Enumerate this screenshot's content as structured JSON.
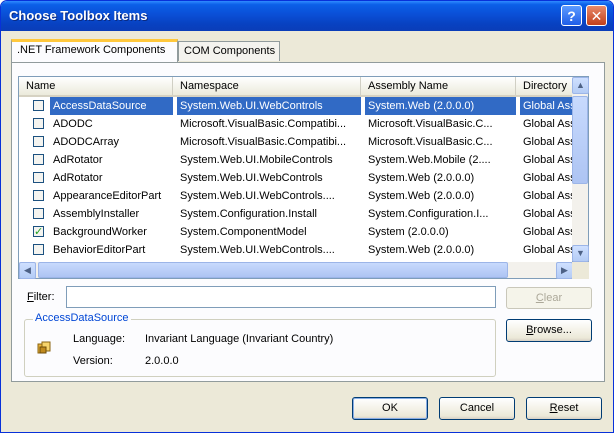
{
  "window": {
    "title": "Choose Toolbox Items",
    "help_glyph": "?",
    "close_glyph": "✕"
  },
  "tabs": [
    {
      "label": ".NET Framework Components",
      "active": true
    },
    {
      "label": "COM Components",
      "active": false
    }
  ],
  "list": {
    "columns": [
      "Name",
      "Namespace",
      "Assembly Name",
      "Directory"
    ],
    "rows": [
      {
        "checked": false,
        "selected": true,
        "name": "AccessDataSource",
        "namespace": "System.Web.UI.WebControls",
        "assembly": "System.Web (2.0.0.0)",
        "directory": "Global Ass"
      },
      {
        "checked": false,
        "selected": false,
        "name": "ADODC",
        "namespace": "Microsoft.VisualBasic.Compatibi...",
        "assembly": "Microsoft.VisualBasic.C...",
        "directory": "Global Ass"
      },
      {
        "checked": false,
        "selected": false,
        "name": "ADODCArray",
        "namespace": "Microsoft.VisualBasic.Compatibi...",
        "assembly": "Microsoft.VisualBasic.C...",
        "directory": "Global Ass"
      },
      {
        "checked": false,
        "selected": false,
        "name": "AdRotator",
        "namespace": "System.Web.UI.MobileControls",
        "assembly": "System.Web.Mobile (2....",
        "directory": "Global Ass"
      },
      {
        "checked": false,
        "selected": false,
        "name": "AdRotator",
        "namespace": "System.Web.UI.WebControls",
        "assembly": "System.Web (2.0.0.0)",
        "directory": "Global Ass"
      },
      {
        "checked": false,
        "selected": false,
        "name": "AppearanceEditorPart",
        "namespace": "System.Web.UI.WebControls....",
        "assembly": "System.Web (2.0.0.0)",
        "directory": "Global Ass"
      },
      {
        "checked": false,
        "selected": false,
        "name": "AssemblyInstaller",
        "namespace": "System.Configuration.Install",
        "assembly": "System.Configuration.I...",
        "directory": "Global Ass"
      },
      {
        "checked": true,
        "selected": false,
        "name": "BackgroundWorker",
        "namespace": "System.ComponentModel",
        "assembly": "System (2.0.0.0)",
        "directory": "Global Ass"
      },
      {
        "checked": false,
        "selected": false,
        "name": "BehaviorEditorPart",
        "namespace": "System.Web.UI.WebControls....",
        "assembly": "System.Web (2.0.0.0)",
        "directory": "Global Ass"
      }
    ]
  },
  "filter": {
    "label_prefix": "F",
    "label_rest": "ilter:",
    "value": "",
    "clear_prefix": "C",
    "clear_rest": "lear"
  },
  "details": {
    "group_title": "AccessDataSource",
    "language_label": "Language:",
    "language_value": "Invariant Language (Invariant Country)",
    "version_label": "Version:",
    "version_value": "2.0.0.0",
    "browse_prefix": "B",
    "browse_rest": "rowse..."
  },
  "buttons": {
    "ok": "OK",
    "cancel": "Cancel",
    "reset_prefix": "R",
    "reset_rest": "eset"
  }
}
